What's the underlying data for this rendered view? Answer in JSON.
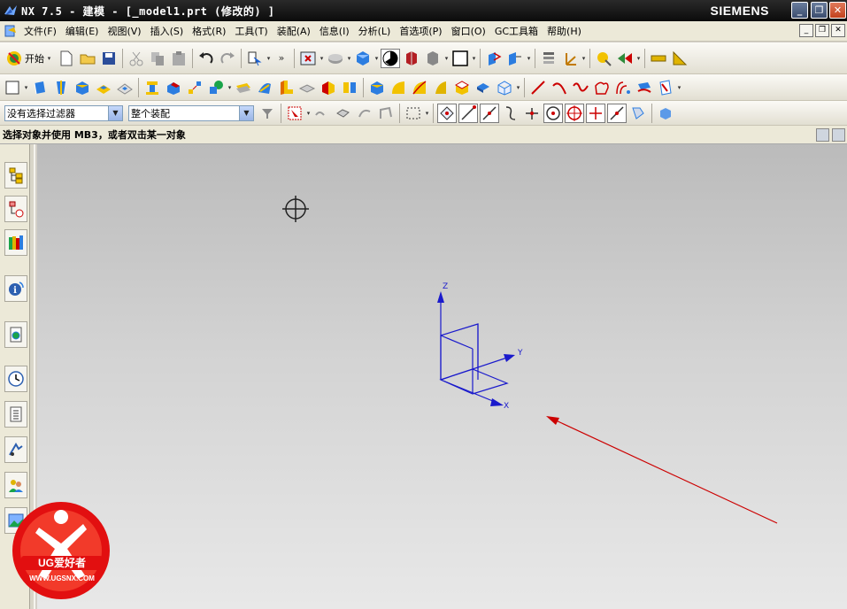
{
  "window": {
    "title": "NX 7.5 - 建模 - [_model1.prt  (修改的) ]",
    "brand": "SIEMENS",
    "min_glyph": "_",
    "max_glyph": "❐",
    "close_glyph": "✕"
  },
  "menu": {
    "items": [
      "文件(F)",
      "编辑(E)",
      "视图(V)",
      "插入(S)",
      "格式(R)",
      "工具(T)",
      "装配(A)",
      "信息(I)",
      "分析(L)",
      "首选项(P)",
      "窗口(O)",
      "GC工具箱",
      "帮助(H)"
    ],
    "doc_min": "_",
    "doc_restore": "❐",
    "doc_close": "✕"
  },
  "toolbar": {
    "start_label": "开始",
    "more_glyph": "»"
  },
  "selection_bar": {
    "filter_value": "没有选择过滤器",
    "scope_value": "整个装配"
  },
  "cue_line": {
    "text": "选择对象并使用 MB3，或者双击某一对象"
  },
  "viewport": {
    "wcs": {
      "z_label": "Z",
      "y_label": "Y",
      "x_label": "X"
    },
    "wcs_color": "#1a1acc",
    "arrow_color": "#cc0000"
  },
  "watermark": {
    "text_logo": "UG爱好者",
    "url": "WWW.UGSNX.COM"
  }
}
